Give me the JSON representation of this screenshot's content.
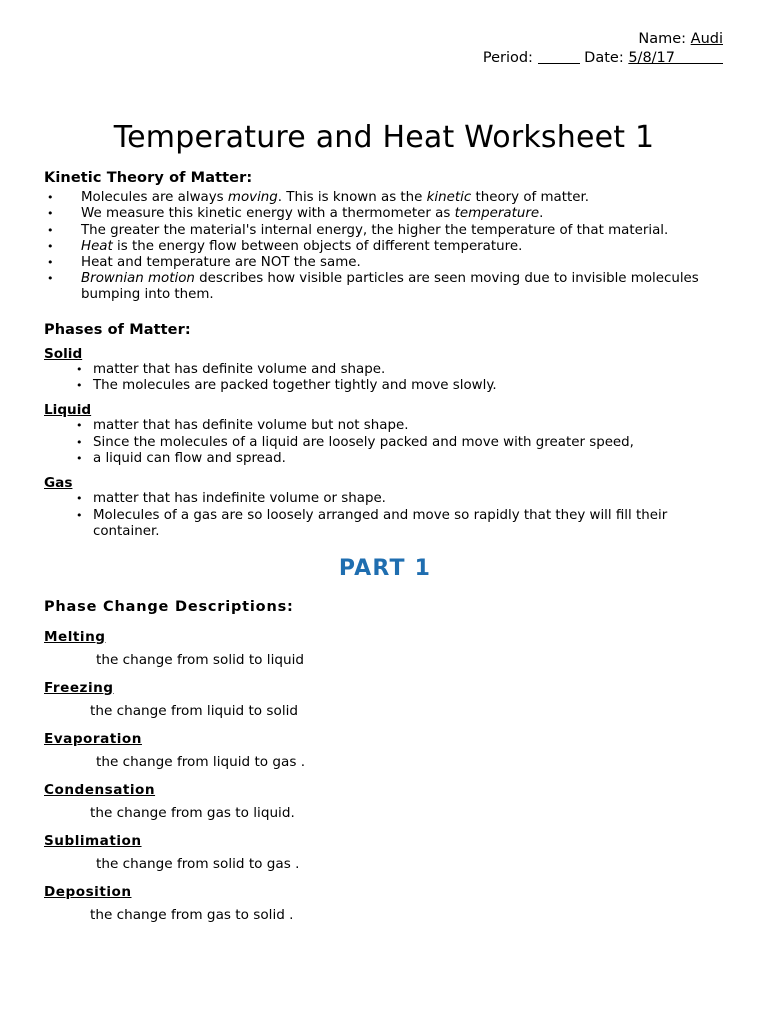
{
  "header": {
    "name_label": "Name:",
    "name_value": "Audi",
    "period_label": "Period:",
    "date_label": "Date:",
    "date_value": "5/8/17"
  },
  "title": "Temperature and Heat Worksheet 1",
  "sections": {
    "kinetic": {
      "heading": "Kinetic Theory of Matter:",
      "bullets": [
        {
          "pre": "Molecules are always ",
          "em1": "moving",
          "mid": ". This is known as the ",
          "em2": "kinetic",
          "post": " theory of matter."
        },
        {
          "pre": "We measure this kinetic energy with a thermometer as ",
          "em1": "temperature",
          "mid": ".",
          "em2": "",
          "post": ""
        },
        {
          "pre": "The greater the material's internal energy, the higher the temperature of that material.",
          "em1": "",
          "mid": "",
          "em2": "",
          "post": ""
        },
        {
          "pre": "",
          "em1": "Heat",
          "mid": " is the energy flow between objects of different temperature.",
          "em2": "",
          "post": ""
        },
        {
          "pre": "Heat and temperature are NOT the same.",
          "em1": "",
          "mid": "",
          "em2": "",
          "post": ""
        },
        {
          "pre": "",
          "em1": "Brownian motion",
          "mid": " describes how visible particles are seen moving due to invisible molecules bumping into them.",
          "em2": "",
          "post": ""
        }
      ]
    },
    "phases": {
      "heading": "Phases of Matter:",
      "groups": [
        {
          "term": "Solid",
          "bullets": [
            "matter that has definite volume and shape.",
            "The molecules are packed together tightly and move slowly."
          ]
        },
        {
          "term": "Liquid",
          "bullets": [
            "matter that has definite volume but not shape.",
            "Since the molecules of a liquid are loosely packed and move with greater speed,",
            "a liquid can flow and spread."
          ]
        },
        {
          "term": "Gas",
          "bullets": [
            "matter that has indefinite volume or shape.",
            "Molecules of a gas are so loosely arranged and move so rapidly that they will fill their container."
          ]
        }
      ]
    },
    "part": {
      "label": "PART 1",
      "color": "#1F6EB0"
    },
    "phase_changes": {
      "heading": "Phase Change Descriptions:",
      "items": [
        {
          "term": "Melting",
          "answer": "the change from solid to liquid"
        },
        {
          "term": "Freezing",
          "answer": "the change from liquid to solid"
        },
        {
          "term": "Evaporation",
          "answer": "the change from liquid to gas ."
        },
        {
          "term": "Condensation",
          "answer": "the change from gas to liquid."
        },
        {
          "term": "Sublimation",
          "answer": "the change from solid to gas ."
        },
        {
          "term": "Deposition",
          "answer": "the change from gas to solid  ."
        }
      ]
    }
  }
}
